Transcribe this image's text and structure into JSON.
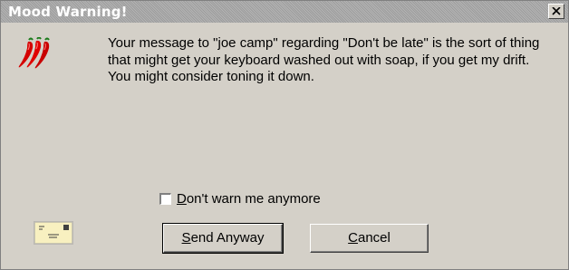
{
  "window": {
    "title": "Mood Warning!",
    "close_symbol": "✕"
  },
  "message": {
    "text": "Your message to \"joe camp\" regarding \"Don't be late\" is the sort of thing that might get your keyboard washed out with soap, if you get my drift. You might consider toning it down.",
    "icon": "hot-peppers-icon"
  },
  "checkbox": {
    "label_accel": "D",
    "label_rest": "on't warn me anymore",
    "checked": false
  },
  "buttons": {
    "send_accel": "S",
    "send_rest": "end Anyway",
    "cancel_accel": "C",
    "cancel_rest": "ancel"
  },
  "icons": {
    "envelope": "envelope-icon",
    "close": "close-icon"
  },
  "colors": {
    "dialog_bg": "#d4d0c8",
    "titlebar_bg": "#a6a6a6",
    "title_text": "#ffffff",
    "pepper": "#d40000"
  }
}
